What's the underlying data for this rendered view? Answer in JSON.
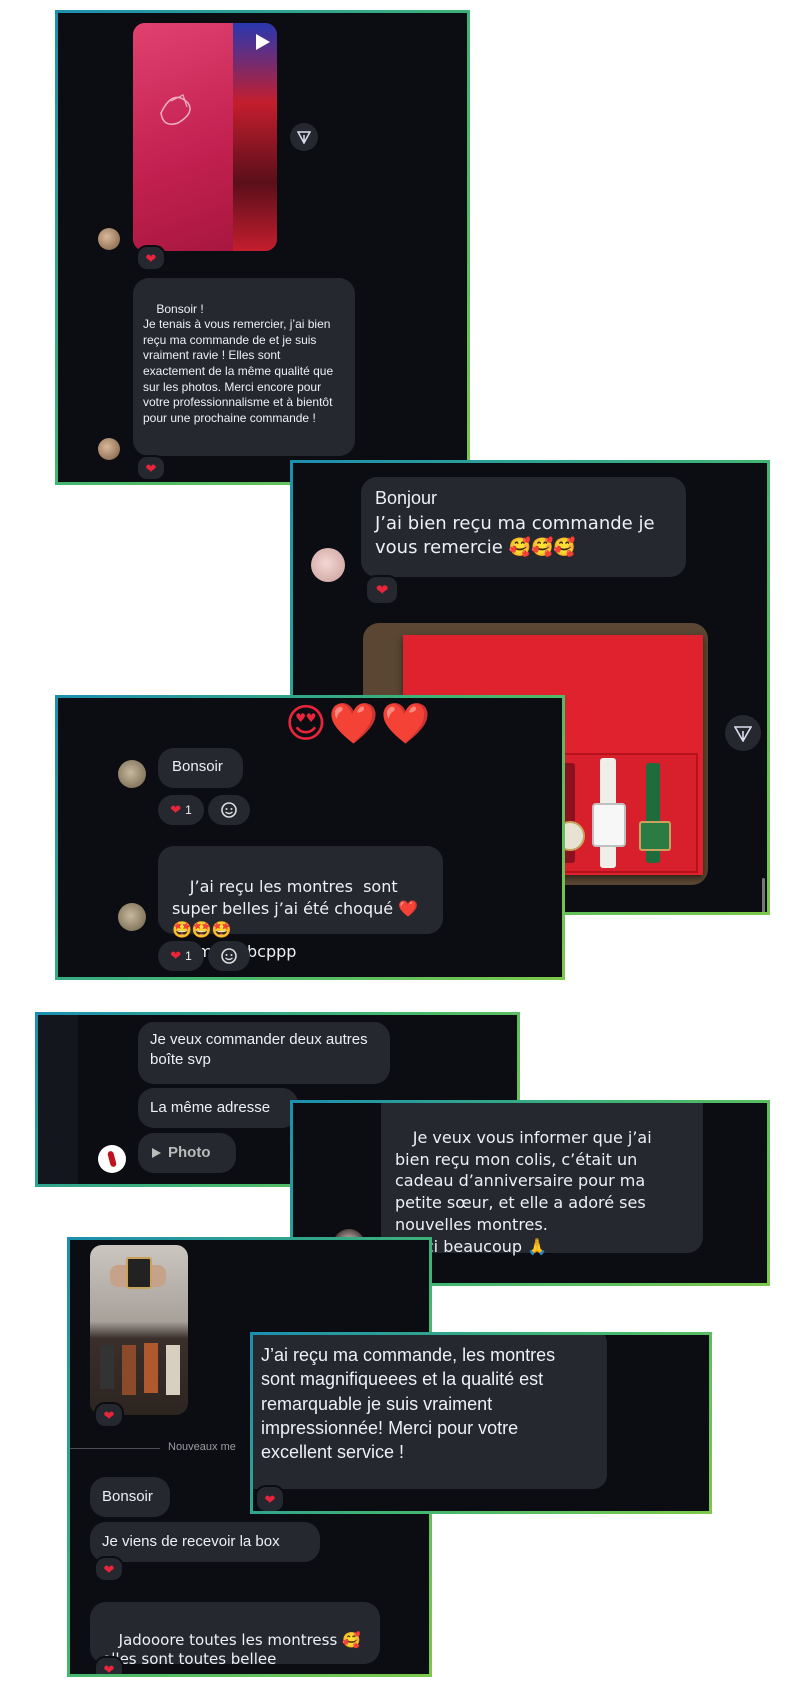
{
  "heart_glyph": "❤",
  "chats": {
    "c1": {
      "message": "Bonsoir !\nJe tenais à vous remercier, j’ai bien reçu ma commande de et je suis vraiment ravie ! Elles sont exactement de la même qualité que sur les photos. Merci encore pour votre professionnalisme et à bientôt pour une prochaine commande !"
    },
    "c2": {
      "message_line1": "Bonjour",
      "message_line2": "J’ai bien reçu ma commande je vous remercie 🥰🥰🥰"
    },
    "c3": {
      "message1": "Bonsoir",
      "reaction_count": "1",
      "message2": "J’ai reçu les montres  sont super belles j’ai été choqué ❤️🤩🤩🤩\n🤩 merci bcppp",
      "floating_reactions": "😍❤️❤️"
    },
    "c4": {
      "message1": "Je veux commander deux autres boîte svp",
      "message2": "La même adresse",
      "photo_label": "Photo"
    },
    "c5": {
      "message": "Je veux vous informer que j’ai bien reçu mon colis, c’était un cadeau d’anniversaire pour ma petite sœur, et elle a adoré ses nouvelles montres.\nMerci beaucoup 🙏"
    },
    "c6": {
      "divider_label": "Nouveaux me",
      "message1": "Bonsoir",
      "message2": "Je viens de recevoir la box",
      "message3": "Jadooore toutes les montress 🥰\nelles sont toutes bellee"
    },
    "c7": {
      "message": "J’ai reçu ma commande, les montres sont magnifiqueees et la qualité est remarquable je suis vraiment impressionnée! Merci pour votre excellent service !"
    }
  }
}
